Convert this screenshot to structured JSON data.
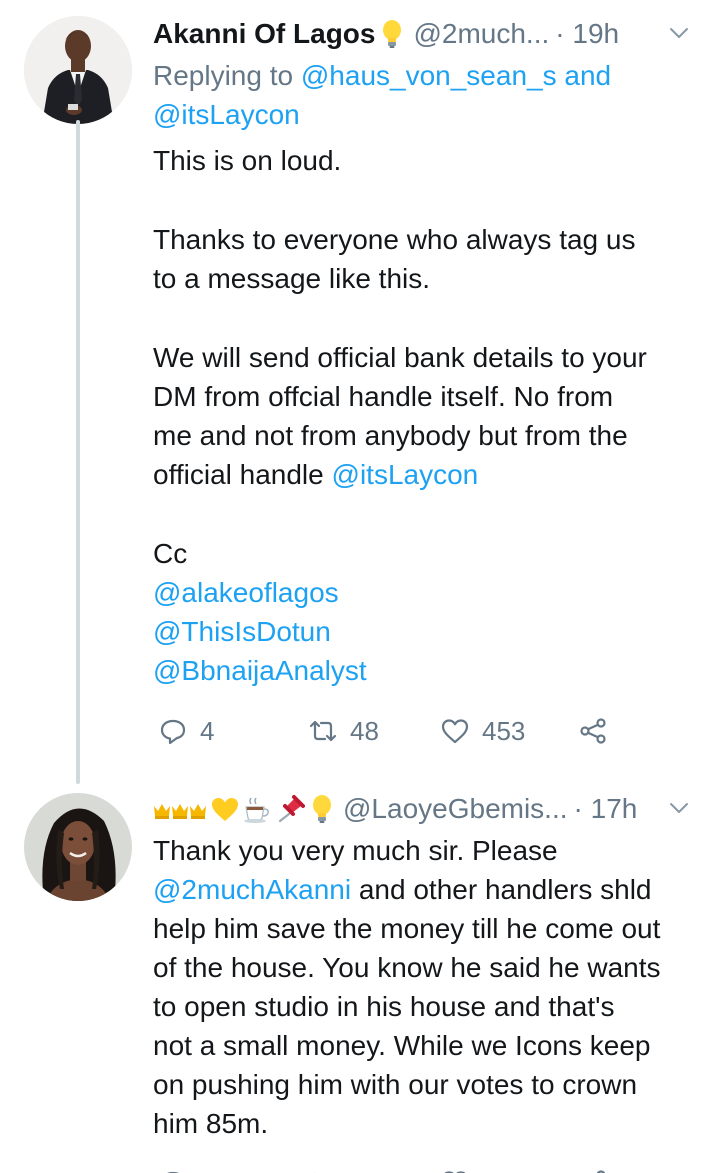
{
  "tweet1": {
    "display_name": "Akanni Of Lagos",
    "emoji_icon": "light-bulb-icon",
    "handle": "@2much...",
    "time": "· 19h",
    "replying": {
      "prefix": "Replying to",
      "user1": "@haus_von_sean_s",
      "and": "and",
      "user2": "@itsLaycon"
    },
    "lines": [
      "This is on loud.",
      "Thanks to everyone who always tag us",
      "to a message like this.",
      "We will send official bank details to your",
      "DM from offcial handle itself. No from",
      "me and not from anybody but from the"
    ],
    "line_official_prefix": "official handle",
    "line_official_mention": "@itsLaycon",
    "cc": "Cc",
    "mentions": [
      "@alakeoflagos",
      "@ThisIsDotun",
      "@BbnaijaAnalyst"
    ],
    "stats": {
      "replies": "4",
      "retweets": "48",
      "likes": "453"
    }
  },
  "tweet2": {
    "emoji_icons": [
      "crown-icon",
      "crown-icon",
      "crown-icon",
      "yellow-heart-icon",
      "coffee-icon",
      "pin-icon",
      "light-bulb-icon"
    ],
    "handle": "@LaoyeGbemis...",
    "time": "· 17h",
    "line1": "Thank you very much sir. Please",
    "line2_mention": "@2muchAkanni",
    "line2_rest": " and other handlers shld",
    "lines": [
      "help him save the money till he come out",
      "of the house. You know he said he wants",
      "to open studio in his house and that's",
      "not a small money. While we Icons keep",
      "on pushing him with our votes to crown",
      "him 85m."
    ]
  },
  "colors": {
    "link": "#1da1f2",
    "muted": "#657786",
    "text": "#14171a",
    "thread_line": "#cfd9de"
  }
}
